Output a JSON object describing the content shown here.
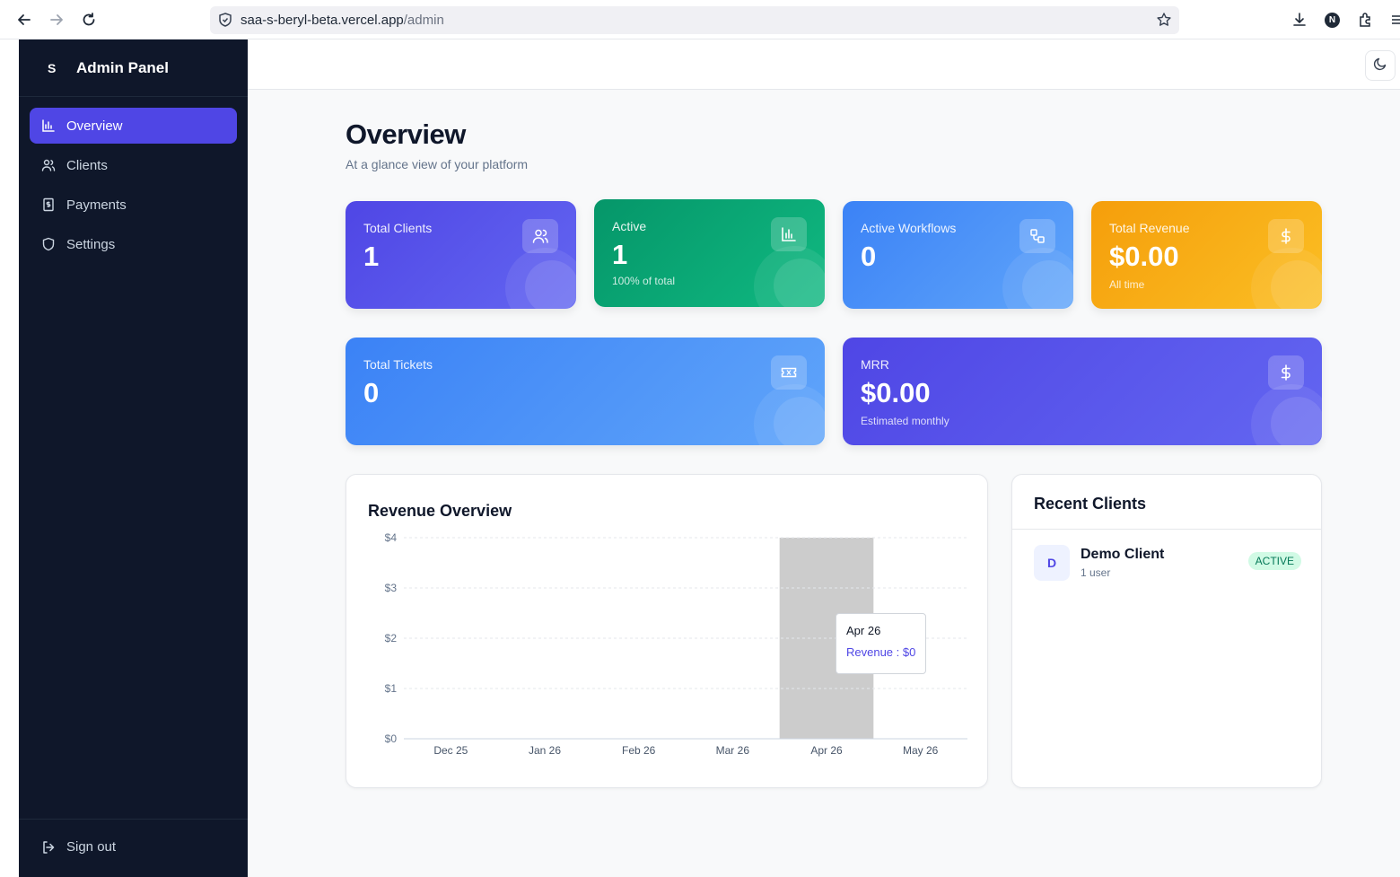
{
  "browser": {
    "url_host": "saa-s-beryl-beta.vercel.app",
    "url_path": "/admin",
    "profile_initial": "N"
  },
  "sidebar": {
    "logo_letter": "S",
    "title": "Admin Panel",
    "items": [
      {
        "label": "Overview",
        "icon": "bar-chart-icon",
        "active": true
      },
      {
        "label": "Clients",
        "icon": "users-icon",
        "active": false
      },
      {
        "label": "Payments",
        "icon": "receipt-icon",
        "active": false
      },
      {
        "label": "Settings",
        "icon": "shield-icon",
        "active": false
      }
    ],
    "signout_label": "Sign out"
  },
  "header": {
    "title": "Overview",
    "subtitle": "At a glance view of your platform"
  },
  "stats": {
    "total_clients": {
      "label": "Total Clients",
      "value": "1",
      "color": "#4f46e5"
    },
    "active": {
      "label": "Active",
      "value": "1",
      "note": "100% of total",
      "color": "#059669"
    },
    "active_workflows": {
      "label": "Active Workflows",
      "value": "0",
      "color": "#3b82f6"
    },
    "total_revenue": {
      "label": "Total Revenue",
      "value": "$0.00",
      "note": "All time",
      "color": "#f59e0b"
    },
    "total_tickets": {
      "label": "Total Tickets",
      "value": "0",
      "color": "#3b82f6"
    },
    "mrr": {
      "label": "MRR",
      "value": "$0.00",
      "note": "Estimated monthly",
      "color": "#4f46e5"
    }
  },
  "revenue_panel": {
    "title": "Revenue Overview",
    "tooltip": {
      "title": "Apr 26",
      "line": "Revenue : $0"
    }
  },
  "chart_data": {
    "type": "bar",
    "title": "Revenue Overview",
    "categories": [
      "Dec 25",
      "Jan 26",
      "Feb 26",
      "Mar 26",
      "Apr 26",
      "May 26"
    ],
    "series": [
      {
        "name": "Revenue",
        "values": [
          0,
          0,
          0,
          0,
          0,
          0
        ]
      }
    ],
    "yticks": [
      "$0",
      "$1",
      "$2",
      "$3",
      "$4"
    ],
    "ylim": [
      0,
      4
    ],
    "grid": true,
    "hovered_category": "Apr 26"
  },
  "recent_clients": {
    "title": "Recent Clients",
    "items": [
      {
        "initial": "D",
        "name": "Demo Client",
        "sub": "1 user",
        "status": "ACTIVE"
      }
    ]
  }
}
